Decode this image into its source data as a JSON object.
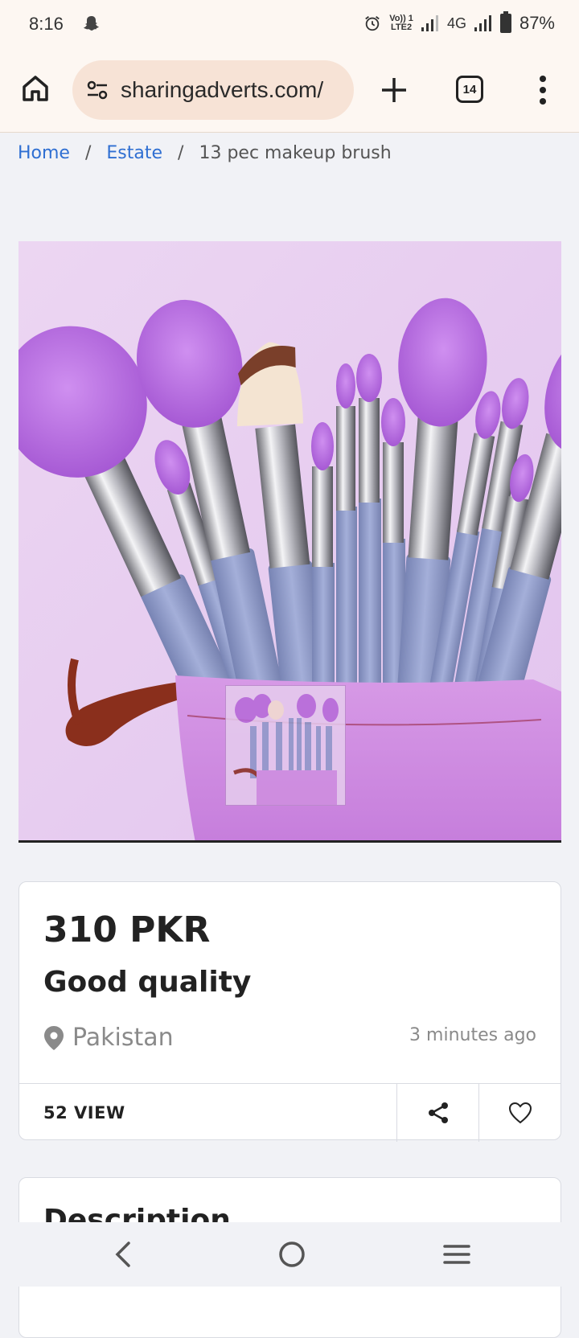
{
  "status_bar": {
    "time": "8:16",
    "network_label_top": "Vo)) 1",
    "network_label_bottom": "LTE2",
    "network_type": "4G",
    "battery": "87%"
  },
  "browser": {
    "url": "sharingadverts.com/",
    "tab_count": "14",
    "icons": [
      "home-icon",
      "site-settings-icon",
      "plus-icon",
      "tabs-icon",
      "more-vert-icon"
    ]
  },
  "breadcrumb": {
    "home": "Home",
    "category": "Estate",
    "current": "13 pec makeup brush",
    "separator": "/"
  },
  "listing": {
    "price": "310 PKR",
    "title": "Good quality",
    "location": "Pakistan",
    "posted": "3 minutes ago",
    "views": "52 VIEW"
  },
  "description": {
    "heading": "Description"
  },
  "colors": {
    "link": "#2f6fd2",
    "chrome_bg": "#fdf7f2",
    "url_pill": "#f7e3d6",
    "brush_bristle": "#b76be0",
    "brush_handle": "#8e9bc9"
  }
}
